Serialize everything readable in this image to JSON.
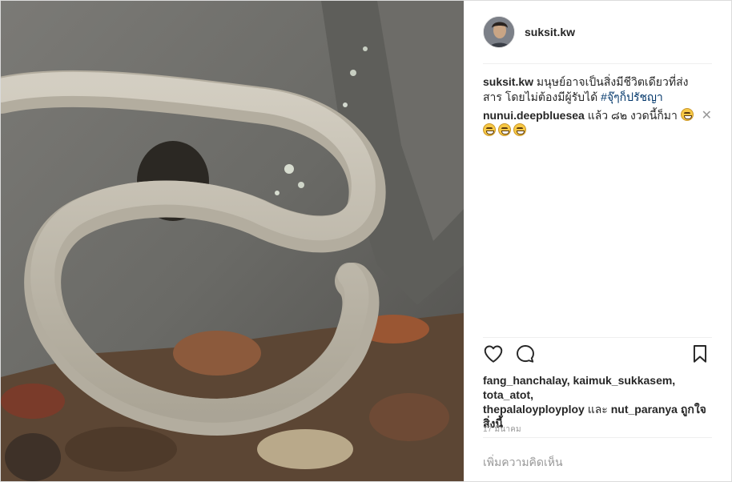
{
  "post": {
    "username": "suksit.kw",
    "caption_user": "suksit.kw",
    "caption_text": "มนุษย์อาจเป็นสิ่งมีชีวิตเดียวที่ส่งสาร โดยไม่ต้องมีผู้รับได้",
    "hashtag": "#จุ๊ๆก็ปรัชญา",
    "comment": {
      "user": "nunui.deepbluesea",
      "text": "แล้ว ๘๒ งวดนี้ก็มา"
    },
    "likes": {
      "names_line1": "fang_hanchalay, kaimuk_sukkasem, tota_atot,",
      "names_line2": "thepalaloyployploy",
      "and": "และ",
      "last_name": "nut_paranya",
      "suffix": "ถูกใจสิ่งนี้"
    },
    "date": "17 มีนาคม",
    "add_comment_placeholder": "เพิ่มความคิดเห็น"
  },
  "icons": [
    "heart-icon",
    "comment-icon",
    "bookmark-icon",
    "close-icon",
    "grinning-sweat-emoji"
  ]
}
